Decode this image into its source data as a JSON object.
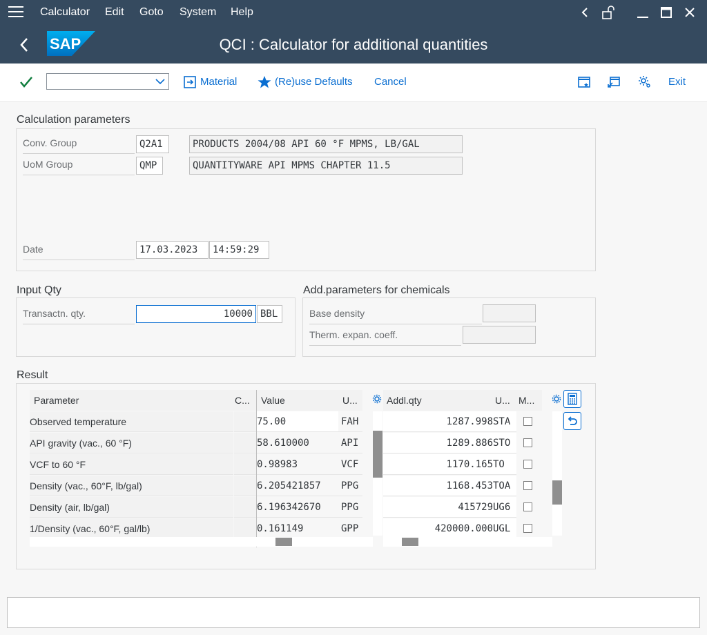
{
  "menu": {
    "items": [
      "Calculator",
      "Edit",
      "Goto",
      "System",
      "Help"
    ]
  },
  "window": {
    "title": "QCI : Calculator for additional quantities",
    "logo_text": "SAP"
  },
  "toolbar": {
    "material_label": "Material",
    "reuse_label": "(Re)use Defaults",
    "cancel_label": "Cancel",
    "exit_label": "Exit",
    "command_value": ""
  },
  "calc": {
    "section_title": "Calculation parameters",
    "conv_group_label": "Conv. Group",
    "conv_group_code": "Q2A1",
    "conv_group_desc": "PRODUCTS 2004/08 API 60 °F MPMS, LB/GAL",
    "uom_group_label": "UoM Group",
    "uom_group_code": "QMP",
    "uom_group_desc": "QUANTITYWARE API MPMS CHAPTER 11.5",
    "date_label": "Date",
    "date_value": "17.03.2023",
    "time_value": "14:59:29"
  },
  "input_qty": {
    "section_title": "Input Qty",
    "transaction_label": "Transactn. qty.",
    "transaction_value": "10000",
    "unit": "BBL"
  },
  "chem": {
    "section_title": "Add.parameters for chemicals",
    "base_density_label": "Base density",
    "base_density_value": "",
    "therm_label": "Therm. expan. coeff.",
    "therm_value": ""
  },
  "result": {
    "section_title": "Result",
    "left_headers": {
      "parameter": "Parameter",
      "c": "C...",
      "value": "Value",
      "unit": "U..."
    },
    "right_headers": {
      "addl": "Addl.qty",
      "unit": "U...",
      "m": "M..."
    },
    "rows": [
      {
        "parameter": "Observed temperature",
        "value": "75.00",
        "unit": "FAH"
      },
      {
        "parameter": "API gravity (vac., 60 °F)",
        "value": "58.610000",
        "unit": "API"
      },
      {
        "parameter": "VCF to 60 °F",
        "value": "0.98983",
        "unit": "VCF"
      },
      {
        "parameter": "Density (vac., 60°F, lb/gal)",
        "value": "6.205421857",
        "unit": "PPG"
      },
      {
        "parameter": "Density (air, lb/gal)",
        "value": "6.196342670",
        "unit": "PPG"
      },
      {
        "parameter": "1/Density (vac., 60°F, gal/lb)",
        "value": "0.161149",
        "unit": "GPP"
      }
    ],
    "addl_rows": [
      {
        "qty": "1287.998",
        "unit": "STA",
        "m": false
      },
      {
        "qty": "1289.886",
        "unit": "STO",
        "m": false
      },
      {
        "qty": "1170.165",
        "unit": "TO",
        "m": false
      },
      {
        "qty": "1168.453",
        "unit": "TOA",
        "m": false
      },
      {
        "qty": "415729",
        "unit": "UG6",
        "m": false
      },
      {
        "qty": "420000.000",
        "unit": "UGL",
        "m": false
      }
    ]
  },
  "colors": {
    "shell": "#354a5f",
    "accent": "#0a6ed1",
    "check": "#107e3e"
  },
  "icons": [
    "menu-icon",
    "back-icon",
    "unlock-icon",
    "minimize-icon",
    "maximize-icon",
    "close-icon",
    "check-icon",
    "material-icon",
    "star-icon",
    "layout-icon",
    "resize-icon",
    "gear-icon",
    "calculator-icon",
    "undo-icon"
  ]
}
